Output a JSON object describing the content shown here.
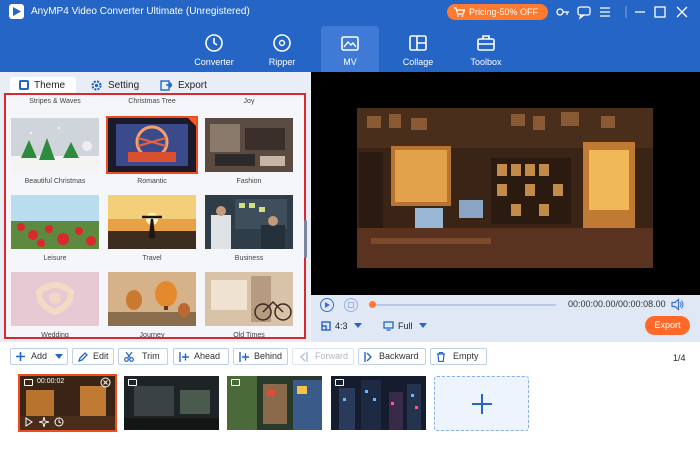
{
  "app": {
    "title": "AnyMP4 Video Converter Ultimate (Unregistered)",
    "promo": "Pricing-50% OFF"
  },
  "nav": {
    "items": [
      {
        "label": "Converter",
        "icon": "converter-icon"
      },
      {
        "label": "Ripper",
        "icon": "disc-icon"
      },
      {
        "label": "MV",
        "icon": "mv-icon"
      },
      {
        "label": "Collage",
        "icon": "collage-icon"
      },
      {
        "label": "Toolbox",
        "icon": "toolbox-icon"
      }
    ],
    "active": "MV"
  },
  "tabs": {
    "theme": "Theme",
    "setting": "Setting",
    "export": "Export"
  },
  "themes": {
    "top_labels": [
      "Stripes & Waves",
      "Christmas Tree",
      "Joy"
    ],
    "items": [
      "Beautiful Christmas",
      "Romantic",
      "Fashion",
      "Leisure",
      "Travel",
      "Business",
      "Wedding",
      "Journey",
      "Old Times"
    ],
    "selected": "Romantic"
  },
  "preview": {
    "time": "00:00:00.00/00:00:08.00",
    "ratio": "4:3",
    "mode": "Full",
    "progress": 0.0,
    "export_label": "Export"
  },
  "toolbar": {
    "add": "Add",
    "edit": "Edit",
    "trim": "Trim",
    "ahead": "Ahead",
    "behind": "Behind",
    "forward": "Forward",
    "backward": "Backward",
    "empty": "Empty",
    "page_count": "1/4"
  },
  "timeline": {
    "clip1_duration": "00:00:02"
  },
  "colors": {
    "brand": "#2465c6",
    "accent": "#ff7a2f",
    "selection": "#d9282f"
  }
}
